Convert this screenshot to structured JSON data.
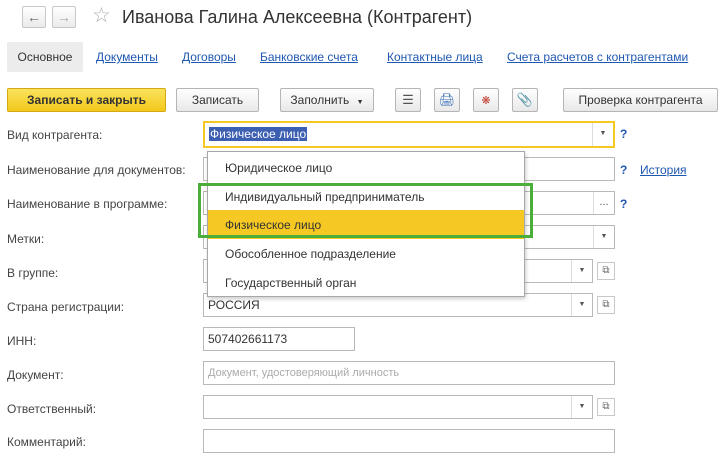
{
  "window": {
    "title": "Иванова Галина Алексеевна (Контрагент)",
    "back_icon": "arrow-left-icon",
    "forward_icon": "arrow-right-icon",
    "favorite_icon": "star-icon"
  },
  "tabs": [
    {
      "label": "Основное",
      "active": true
    },
    {
      "label": "Документы"
    },
    {
      "label": "Договоры"
    },
    {
      "label": "Банковские счета"
    },
    {
      "label": "Контактные лица"
    },
    {
      "label": "Счета расчетов с контрагентами"
    }
  ],
  "toolbar": {
    "save_close_label": "Записать и закрыть",
    "save_label": "Записать",
    "fill_label": "Заполнить",
    "check_label": "Проверка контрагента",
    "icons": [
      "report-icon",
      "print-icon",
      "structure-icon",
      "attachment-icon"
    ]
  },
  "form": {
    "type_label": "Вид контрагента:",
    "type_value": "Физическое лицо",
    "doc_name_label": "Наименование для документов:",
    "history_link": "История",
    "prog_name_label": "Наименование в программе:",
    "tags_label": "Метки:",
    "group_label": "В группе:",
    "country_label": "Страна регистрации:",
    "country_value": "РОССИЯ",
    "inn_label": "ИНН:",
    "inn_value": "507402661173",
    "document_label": "Документ:",
    "document_placeholder": "Документ, удостоверяющий личность",
    "responsible_label": "Ответственный:",
    "comment_label": "Комментарий:",
    "help_mark": "?"
  },
  "dropdown": {
    "options": [
      "Юридическое лицо",
      "Индивидуальный предприниматель",
      "Физическое лицо",
      "Обособленное подразделение",
      "Государственный орган"
    ],
    "selected_index": 2
  },
  "colors": {
    "accent_yellow": "#f5c823",
    "link_blue": "#1f58b0",
    "annotation_green": "#4cae3a",
    "selection_blue": "#3c5fb1"
  }
}
